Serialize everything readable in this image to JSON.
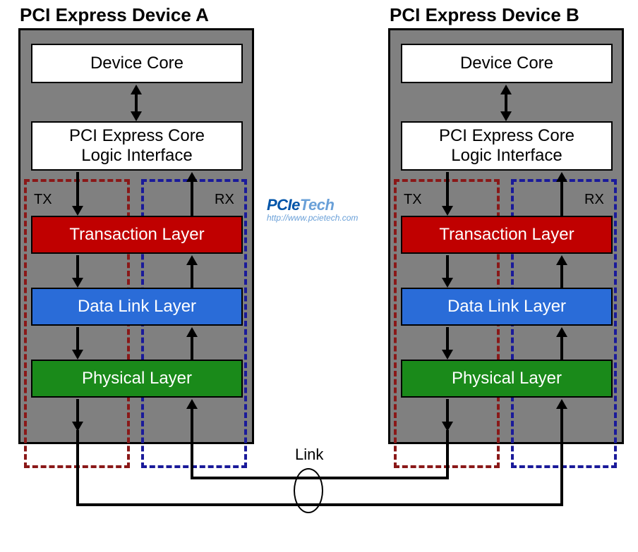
{
  "deviceA": {
    "title": "PCI Express Device A",
    "core": "Device Core",
    "coreLogic1": "PCI Express Core",
    "coreLogic2": "Logic Interface",
    "tx": "TX",
    "rx": "RX",
    "layers": {
      "trans": "Transaction Layer",
      "dlink": "Data Link Layer",
      "phys": "Physical Layer"
    }
  },
  "deviceB": {
    "title": "PCI Express Device B",
    "core": "Device Core",
    "coreLogic1": "PCI Express Core",
    "coreLogic2": "Logic Interface",
    "tx": "TX",
    "rx": "RX",
    "layers": {
      "trans": "Transaction Layer",
      "dlink": "Data Link Layer",
      "phys": "Physical Layer"
    }
  },
  "link": "Link",
  "watermark": {
    "brand1": "PCIe",
    "brand2": "Tech",
    "url": "http://www.pcietech.com"
  }
}
